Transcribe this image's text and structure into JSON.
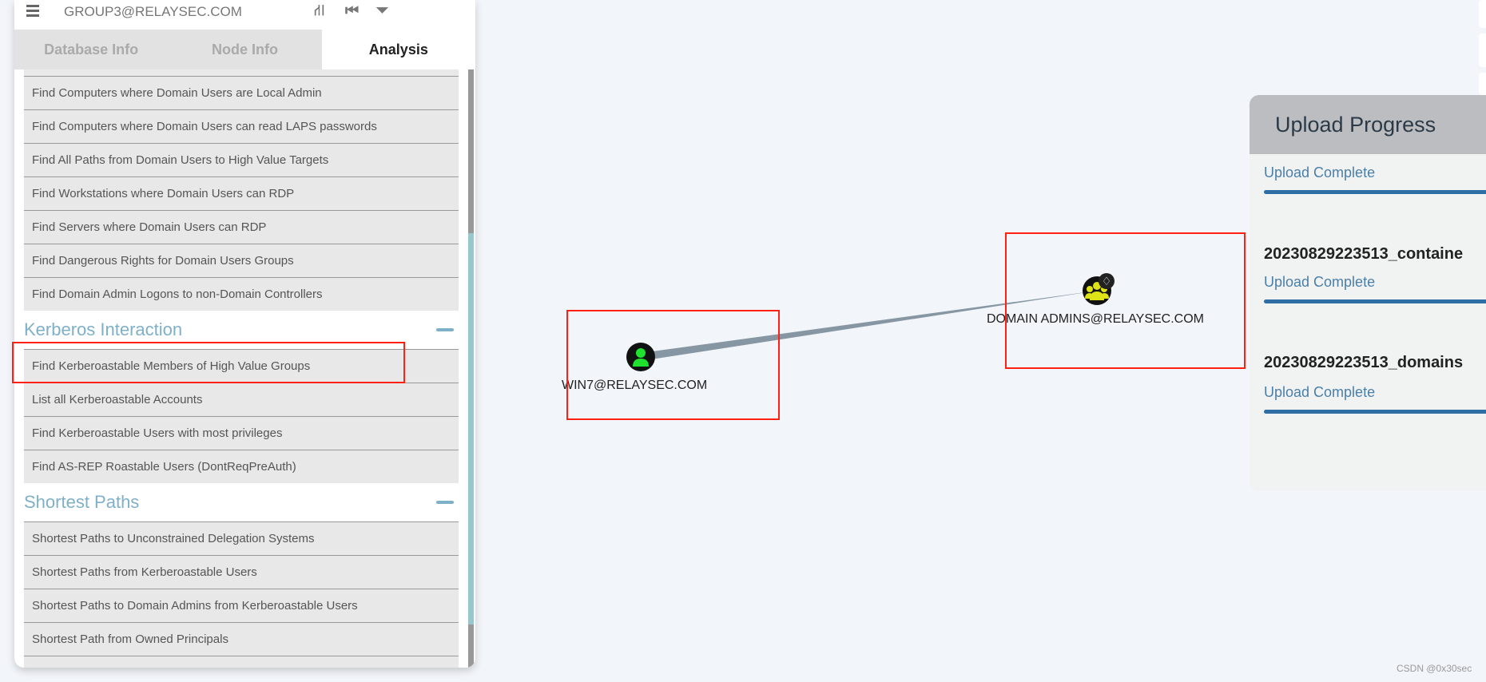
{
  "header": {
    "title": "GROUP3@RELAYSEC.COM",
    "icons": [
      "road-icon",
      "back-icon",
      "filter-icon"
    ]
  },
  "tabs": [
    {
      "label": "Database Info"
    },
    {
      "label": "Node Info"
    },
    {
      "label": "Analysis",
      "active": true
    }
  ],
  "analysis": {
    "domain_items": [
      "Find Computers where Domain Users are Local Admin",
      "Find Computers where Domain Users can read LAPS passwords",
      "Find All Paths from Domain Users to High Value Targets",
      "Find Workstations where Domain Users can RDP",
      "Find Servers where Domain Users can RDP",
      "Find Dangerous Rights for Domain Users Groups",
      "Find Domain Admin Logons to non-Domain Controllers"
    ],
    "kerberos": {
      "title": "Kerberos Interaction",
      "items": [
        "Find Kerberoastable Members of High Value Groups",
        "List all Kerberoastable Accounts",
        "Find Kerberoastable Users with most privileges",
        "Find AS-REP Roastable Users (DontReqPreAuth)"
      ]
    },
    "shortest": {
      "title": "Shortest Paths",
      "items": [
        "Shortest Paths to Unconstrained Delegation Systems",
        "Shortest Paths from Kerberoastable Users",
        "Shortest Paths to Domain Admins from Kerberoastable Users",
        "Shortest Path from Owned Principals"
      ]
    }
  },
  "graph": {
    "nodes": [
      {
        "label": "WIN7@RELAYSEC.COM",
        "type": "user",
        "color": "#1ee22e"
      },
      {
        "label": "DOMAIN ADMINS@RELAYSEC.COM",
        "type": "group",
        "color": "#dde316",
        "high_value": true
      }
    ],
    "edge_color": "#7a8c99"
  },
  "upload": {
    "title": "Upload Progress",
    "entries": [
      {
        "file": "",
        "status": "Upload Complete",
        "progress": 100
      },
      {
        "file": "20230829223513_containe",
        "status": "Upload Complete",
        "progress": 100
      },
      {
        "file": "20230829223513_domains",
        "status": "Upload Complete",
        "progress": 100
      }
    ]
  },
  "watermark": "CSDN @0x30sec"
}
